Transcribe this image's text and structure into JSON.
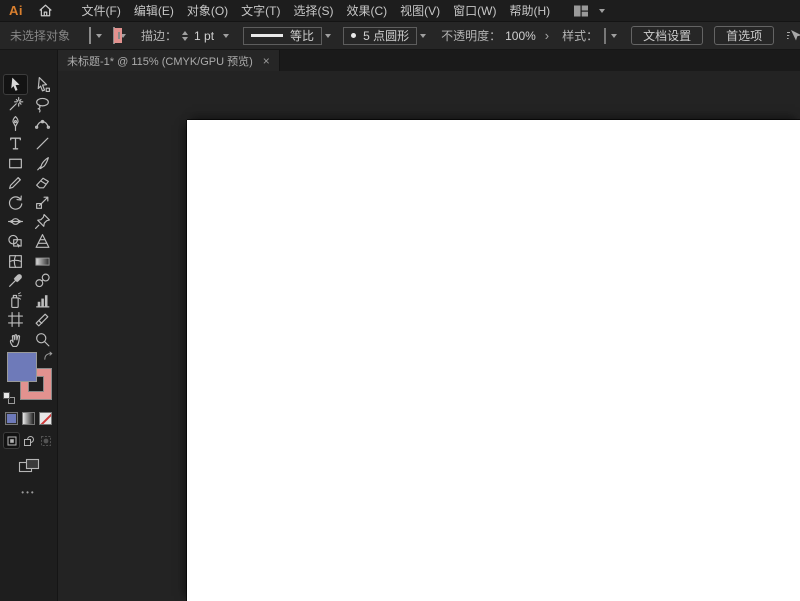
{
  "app": {
    "logo_text": "Ai"
  },
  "colors": {
    "accent_orange": "#d97f2e",
    "fill": "#6e7ab9",
    "stroke": "#e2928f",
    "icon_gray": "#bdbdbd"
  },
  "menubar": {
    "items": [
      "文件(F)",
      "编辑(E)",
      "对象(O)",
      "文字(T)",
      "选择(S)",
      "效果(C)",
      "视图(V)",
      "窗口(W)",
      "帮助(H)"
    ]
  },
  "controlbar": {
    "no_selection_label": "未选择对象",
    "stroke_label": "描边：",
    "stroke_weight_value": "1 pt",
    "width_profile_label": "等比",
    "brush_label": "5 点圆形",
    "opacity_label": "不透明度：",
    "opacity_value": "100%",
    "opacity_panel_arrow": "›",
    "style_label": "样式：",
    "document_setup_label": "文档设置",
    "preferences_label": "首选项"
  },
  "tabbar": {
    "title": "未标题-1* @ 115% (CMYK/GPU 预览)",
    "close_label": "×"
  },
  "toolbar": {
    "tools": [
      {
        "icon": "selection-tool",
        "selected": true
      },
      {
        "icon": "direct-selection-tool"
      },
      {
        "icon": "magic-wand-tool"
      },
      {
        "icon": "lasso-tool"
      },
      {
        "icon": "pen-tool"
      },
      {
        "icon": "curvature-tool"
      },
      {
        "icon": "type-tool"
      },
      {
        "icon": "line-segment-tool"
      },
      {
        "icon": "rectangle-tool"
      },
      {
        "icon": "paintbrush-tool"
      },
      {
        "icon": "pencil-tool"
      },
      {
        "icon": "eraser-tool"
      },
      {
        "icon": "rotate-tool"
      },
      {
        "icon": "scale-tool"
      },
      {
        "icon": "width-tool"
      },
      {
        "icon": "puppet-warp-tool"
      },
      {
        "icon": "shape-builder-tool"
      },
      {
        "icon": "perspective-grid-tool"
      },
      {
        "icon": "mesh-tool"
      },
      {
        "icon": "gradient-tool"
      },
      {
        "icon": "eyedropper-tool"
      },
      {
        "icon": "blend-tool"
      },
      {
        "icon": "symbol-sprayer-tool"
      },
      {
        "icon": "column-graph-tool"
      },
      {
        "icon": "artboard-tool"
      },
      {
        "icon": "slice-tool"
      },
      {
        "icon": "hand-tool"
      },
      {
        "icon": "zoom-tool"
      }
    ],
    "more_label": "•••"
  }
}
